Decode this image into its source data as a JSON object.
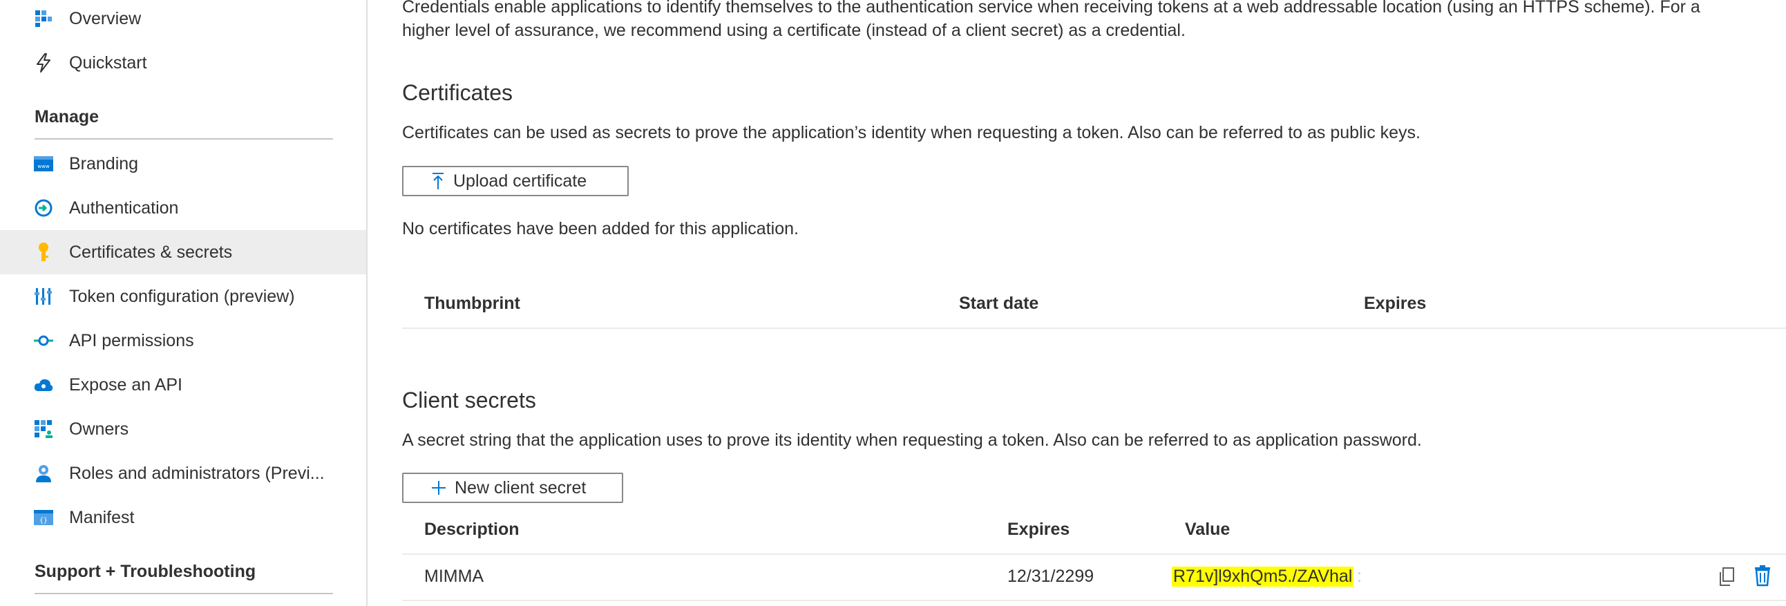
{
  "sidebar": {
    "top_items": [
      {
        "label": "Overview",
        "icon": "overview-icon"
      },
      {
        "label": "Quickstart",
        "icon": "quickstart-icon"
      }
    ],
    "manage_heading": "Manage",
    "manage_items": [
      {
        "label": "Branding",
        "icon": "branding-icon"
      },
      {
        "label": "Authentication",
        "icon": "authentication-icon"
      },
      {
        "label": "Certificates & secrets",
        "icon": "key-icon",
        "active": true
      },
      {
        "label": "Token configuration (preview)",
        "icon": "token-config-icon"
      },
      {
        "label": "API permissions",
        "icon": "api-permissions-icon"
      },
      {
        "label": "Expose an API",
        "icon": "expose-api-icon"
      },
      {
        "label": "Owners",
        "icon": "owners-icon"
      },
      {
        "label": "Roles and administrators (Previ...",
        "icon": "roles-icon"
      },
      {
        "label": "Manifest",
        "icon": "manifest-icon"
      }
    ],
    "support_heading": "Support + Troubleshooting"
  },
  "main": {
    "intro_line1": "Credentials enable applications to identify themselves to the authentication service when receiving tokens at a web addressable location (using an HTTPS scheme). For a",
    "intro_line2": "higher level of assurance, we recommend using a certificate (instead of a client secret) as a credential.",
    "certificates": {
      "title": "Certificates",
      "description": "Certificates can be used as secrets to prove the application’s identity when requesting a token. Also can be referred to as public keys.",
      "upload_button": "Upload certificate",
      "empty_message": "No certificates have been added for this application.",
      "columns": [
        "Thumbprint",
        "Start date",
        "Expires"
      ]
    },
    "client_secrets": {
      "title": "Client secrets",
      "description": "A secret string that the application uses to prove its identity when requesting a token. Also can be referred to as application password.",
      "new_button": "New client secret",
      "columns": [
        "Description",
        "Expires",
        "Value"
      ],
      "rows": [
        {
          "description": "MIMMA",
          "expires": "12/31/2299",
          "value": "R71v]l9xhQm5./ZAVhal",
          "value_tail": ":"
        }
      ]
    }
  },
  "colors": {
    "accent": "#0078d4",
    "active_bg": "#ededed",
    "highlight": "#ffff00"
  }
}
